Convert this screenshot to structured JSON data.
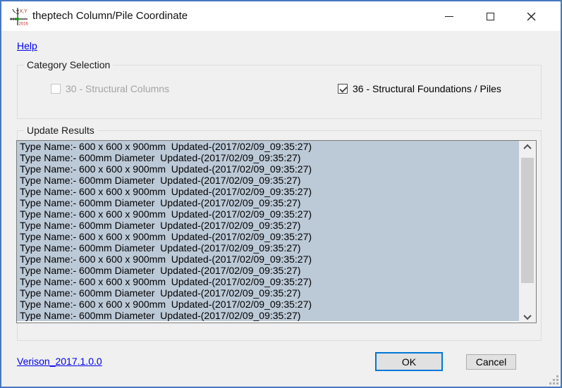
{
  "window": {
    "title": "theptech Column/Pile Coordinate",
    "icon": "coordinate-crosshair-icon",
    "icon_text_top": "X,Y",
    "icon_text_bottom": "2016"
  },
  "help_link": "Help",
  "category_selection": {
    "label": "Category Selection",
    "checkboxes": [
      {
        "label": "30 - Structural Columns",
        "checked": false,
        "enabled": false
      },
      {
        "label": "36 - Structural Foundations / Piles",
        "checked": true,
        "enabled": true
      }
    ]
  },
  "update_results": {
    "label": "Update Results",
    "items": [
      "Type Name:- 600 x 600 x 900mm  Updated-(2017/02/09_09:35:27)",
      "Type Name:- 600mm Diameter  Updated-(2017/02/09_09:35:27)",
      "Type Name:- 600 x 600 x 900mm  Updated-(2017/02/09_09:35:27)",
      "Type Name:- 600mm Diameter  Updated-(2017/02/09_09:35:27)",
      "Type Name:- 600 x 600 x 900mm  Updated-(2017/02/09_09:35:27)",
      "Type Name:- 600mm Diameter  Updated-(2017/02/09_09:35:27)",
      "Type Name:- 600 x 600 x 900mm  Updated-(2017/02/09_09:35:27)",
      "Type Name:- 600mm Diameter  Updated-(2017/02/09_09:35:27)",
      "Type Name:- 600 x 600 x 900mm  Updated-(2017/02/09_09:35:27)",
      "Type Name:- 600mm Diameter  Updated-(2017/02/09_09:35:27)",
      "Type Name:- 600 x 600 x 900mm  Updated-(2017/02/09_09:35:27)",
      "Type Name:- 600mm Diameter  Updated-(2017/02/09_09:35:27)",
      "Type Name:- 600 x 600 x 900mm  Updated-(2017/02/09_09:35:27)",
      "Type Name:- 600mm Diameter  Updated-(2017/02/09_09:35:27)",
      "Type Name:- 600 x 600 x 900mm  Updated-(2017/02/09_09:35:27)",
      "Type Name:- 600mm Diameter  Updated-(2017/02/09_09:35:27)"
    ]
  },
  "footer": {
    "version_link": "Verison_2017.1.0.0",
    "ok_label": "OK",
    "cancel_label": "Cancel"
  },
  "colors": {
    "window_border": "#4878c0",
    "dialog_bg": "#f0f0f0",
    "selection_bg": "#bcc9d7",
    "link": "#0000ee",
    "ok_focus_border": "#0078d7"
  }
}
